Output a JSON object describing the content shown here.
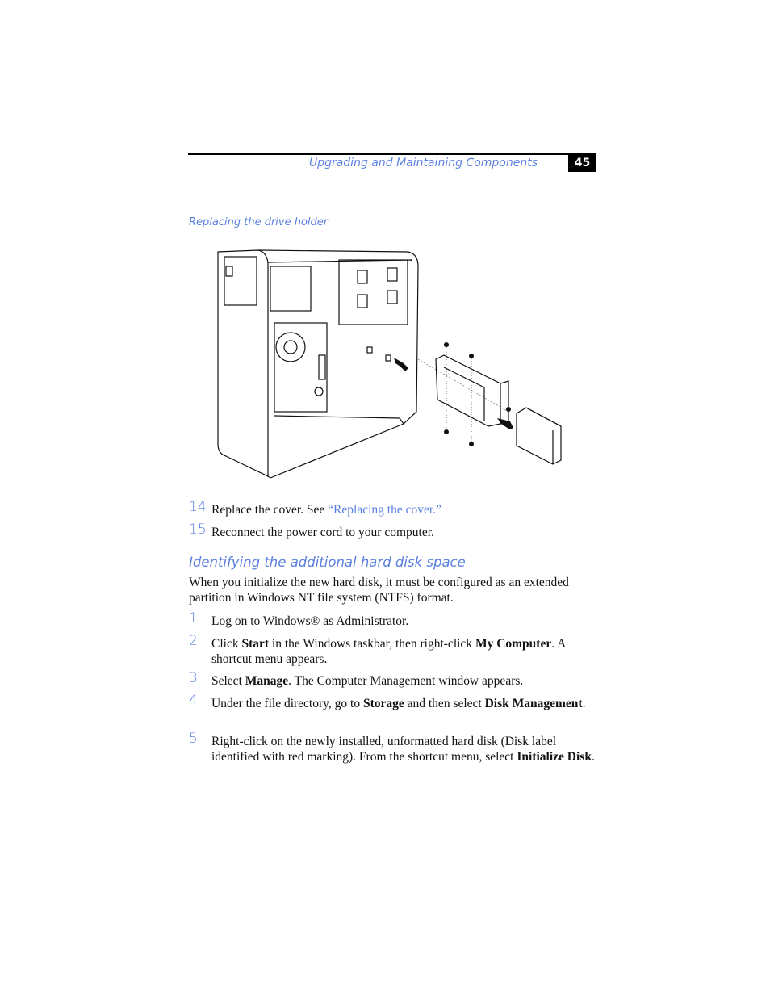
{
  "header": {
    "title": "Upgrading and Maintaining Components",
    "page_number": "45"
  },
  "figure": {
    "caption": "Replacing the drive holder"
  },
  "steps_a": [
    {
      "num": "14",
      "text": "Replace the cover. See ",
      "link": "“Replacing the cover.”"
    },
    {
      "num": "15",
      "text": "Reconnect the power cord to your computer."
    }
  ],
  "section": {
    "title": "Identifying the additional hard disk space",
    "intro": "When you initialize the new hard disk, it must be configured as an extended partition in Windows NT file system (NTFS) format."
  },
  "steps_b": [
    {
      "num": "1",
      "parts": [
        "Log on to Windows® as Administrator."
      ]
    },
    {
      "num": "2",
      "parts": [
        "Click ",
        "Start",
        " in the Windows taskbar, then right-click ",
        "My Computer",
        ". A shortcut menu appears."
      ]
    },
    {
      "num": "3",
      "parts": [
        "Select ",
        "Manage",
        ". The Computer Management window appears."
      ]
    },
    {
      "num": "4",
      "parts": [
        "Under the file directory, go to ",
        "Storage",
        " and then select ",
        "Disk Management",
        "."
      ]
    },
    {
      "num": "5",
      "parts": [
        "Right-click on the newly installed, unformatted hard disk (Disk label identified with red marking). From the shortcut menu, select ",
        "Initialize Disk",
        "."
      ]
    }
  ]
}
